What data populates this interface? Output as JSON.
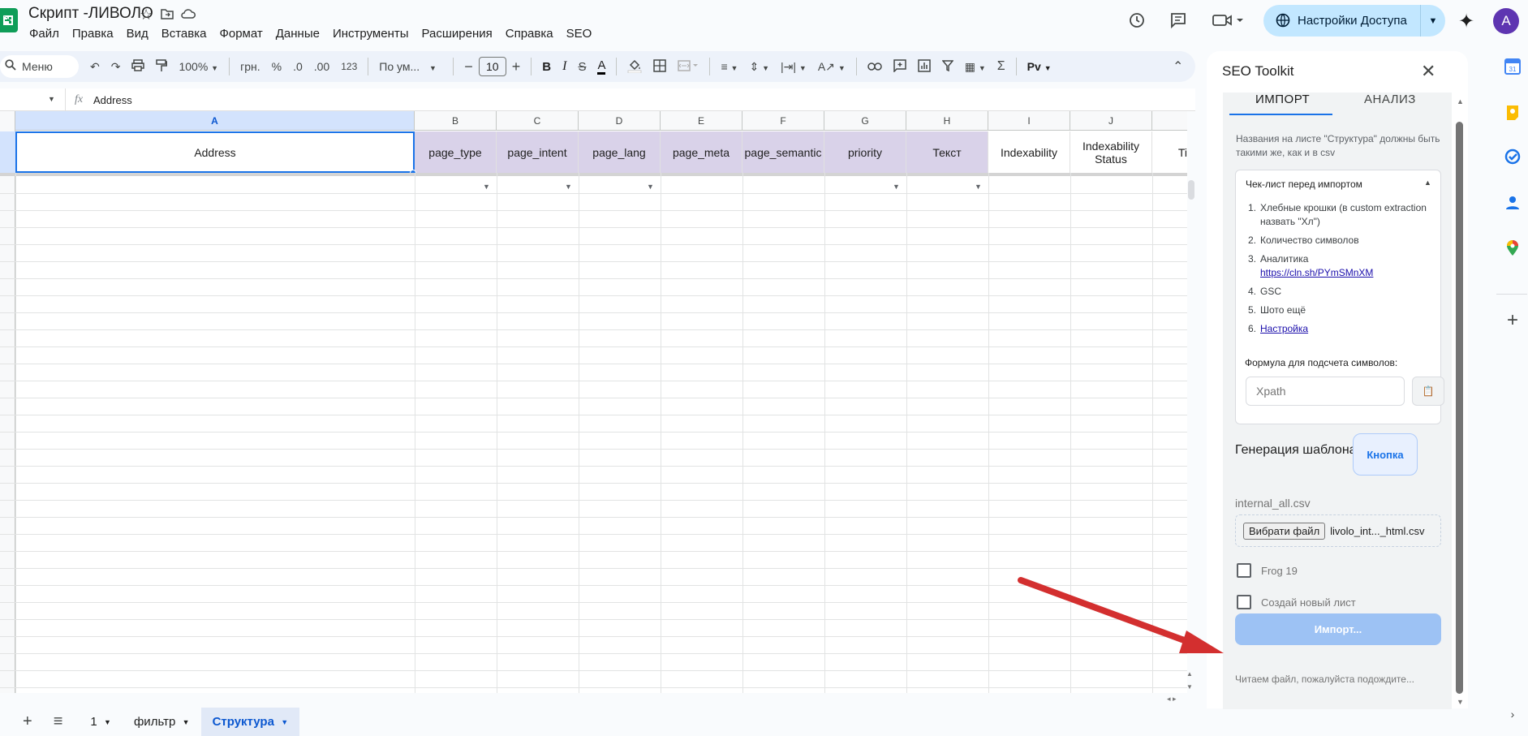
{
  "header": {
    "title": "Скрипт -ЛИВОЛО",
    "menu": [
      "Файл",
      "Правка",
      "Вид",
      "Вставка",
      "Формат",
      "Данные",
      "Инструменты",
      "Расширения",
      "Справка",
      "SEO"
    ],
    "access_button": "Настройки Доступа",
    "avatar_letter": "A"
  },
  "toolbar": {
    "search_label": "Меню",
    "zoom": "100%",
    "currency": "грн.",
    "percent": "%",
    "dec_decrease": ".0",
    "dec_increase": ".00",
    "number_format": "123",
    "font_family": "По ум...",
    "font_size": "10",
    "bold": "B",
    "italic": "I",
    "strike": "S",
    "text_color": "A",
    "sigma": "Σ",
    "pv": "Pv"
  },
  "formula_bar": {
    "fx": "fx",
    "value": "Address"
  },
  "grid": {
    "columns": [
      "A",
      "B",
      "C",
      "D",
      "E",
      "F",
      "G",
      "H",
      "I",
      "J"
    ],
    "header_cells": [
      "Address",
      "page_type",
      "page_intent",
      "page_lang",
      "page_meta",
      "page_semantic",
      "priority",
      "Текст",
      "Indexability",
      "Indexability Status",
      "Ti"
    ]
  },
  "sheets": {
    "tabs": [
      "1",
      "фильтр",
      "Структура"
    ],
    "active": "Структура"
  },
  "panel": {
    "title": "SEO Toolkit",
    "tabs": [
      "ИМПОРТ",
      "АНАЛИЗ"
    ],
    "description": "Названия на листе \"Структура\" должны быть такими же, как и в csv",
    "checklist_title": "Чек-лист перед импортом",
    "checklist": [
      {
        "n": "1.",
        "text": "Хлебные крошки (в custom extraction назвать \"Хл\")"
      },
      {
        "n": "2.",
        "text": "Количество символов"
      },
      {
        "n": "3.",
        "text": "Аналитика",
        "link": "https://cln.sh/PYmSMnXM"
      },
      {
        "n": "4.",
        "text": "GSC"
      },
      {
        "n": "5.",
        "text": "Шото ещё"
      },
      {
        "n": "6.",
        "link": "Настройка"
      }
    ],
    "formula_label": "Формула для подсчета символов:",
    "xpath_placeholder": "Xpath",
    "gen_label": "Генерация шаблона:",
    "gen_button": "Кнопка",
    "file_label": "internal_all.csv",
    "file_button": "Вибрати файл",
    "file_name": "livolo_int..._html.csv",
    "checkbox1": "Frog 19",
    "checkbox2": "Создай новый лист",
    "import_button": "Импорт...",
    "status": "Читаем файл, пожалуйста подождите..."
  },
  "colors": {
    "accent": "#0b57d0",
    "header_purple": "#d9d2e9",
    "import_button": "#9dc2f4",
    "arrow": "#d32f2f"
  }
}
